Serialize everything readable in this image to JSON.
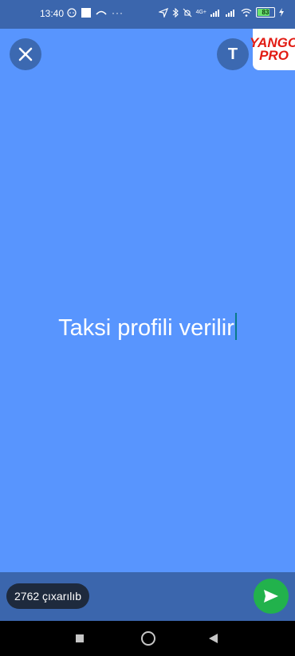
{
  "status_bar": {
    "time": "13:40",
    "network": "4G+",
    "battery": "83"
  },
  "toolbar": {
    "text_mode_button": "T",
    "logo_line1": "YANGO",
    "logo_line2": "PRO"
  },
  "story": {
    "text": "Taksi profili verilir",
    "background_color": "#5895fe"
  },
  "footer": {
    "counter_label": "2762 çıxarılıb"
  },
  "colors": {
    "bar": "#3b66ad",
    "send": "#22b24c"
  }
}
